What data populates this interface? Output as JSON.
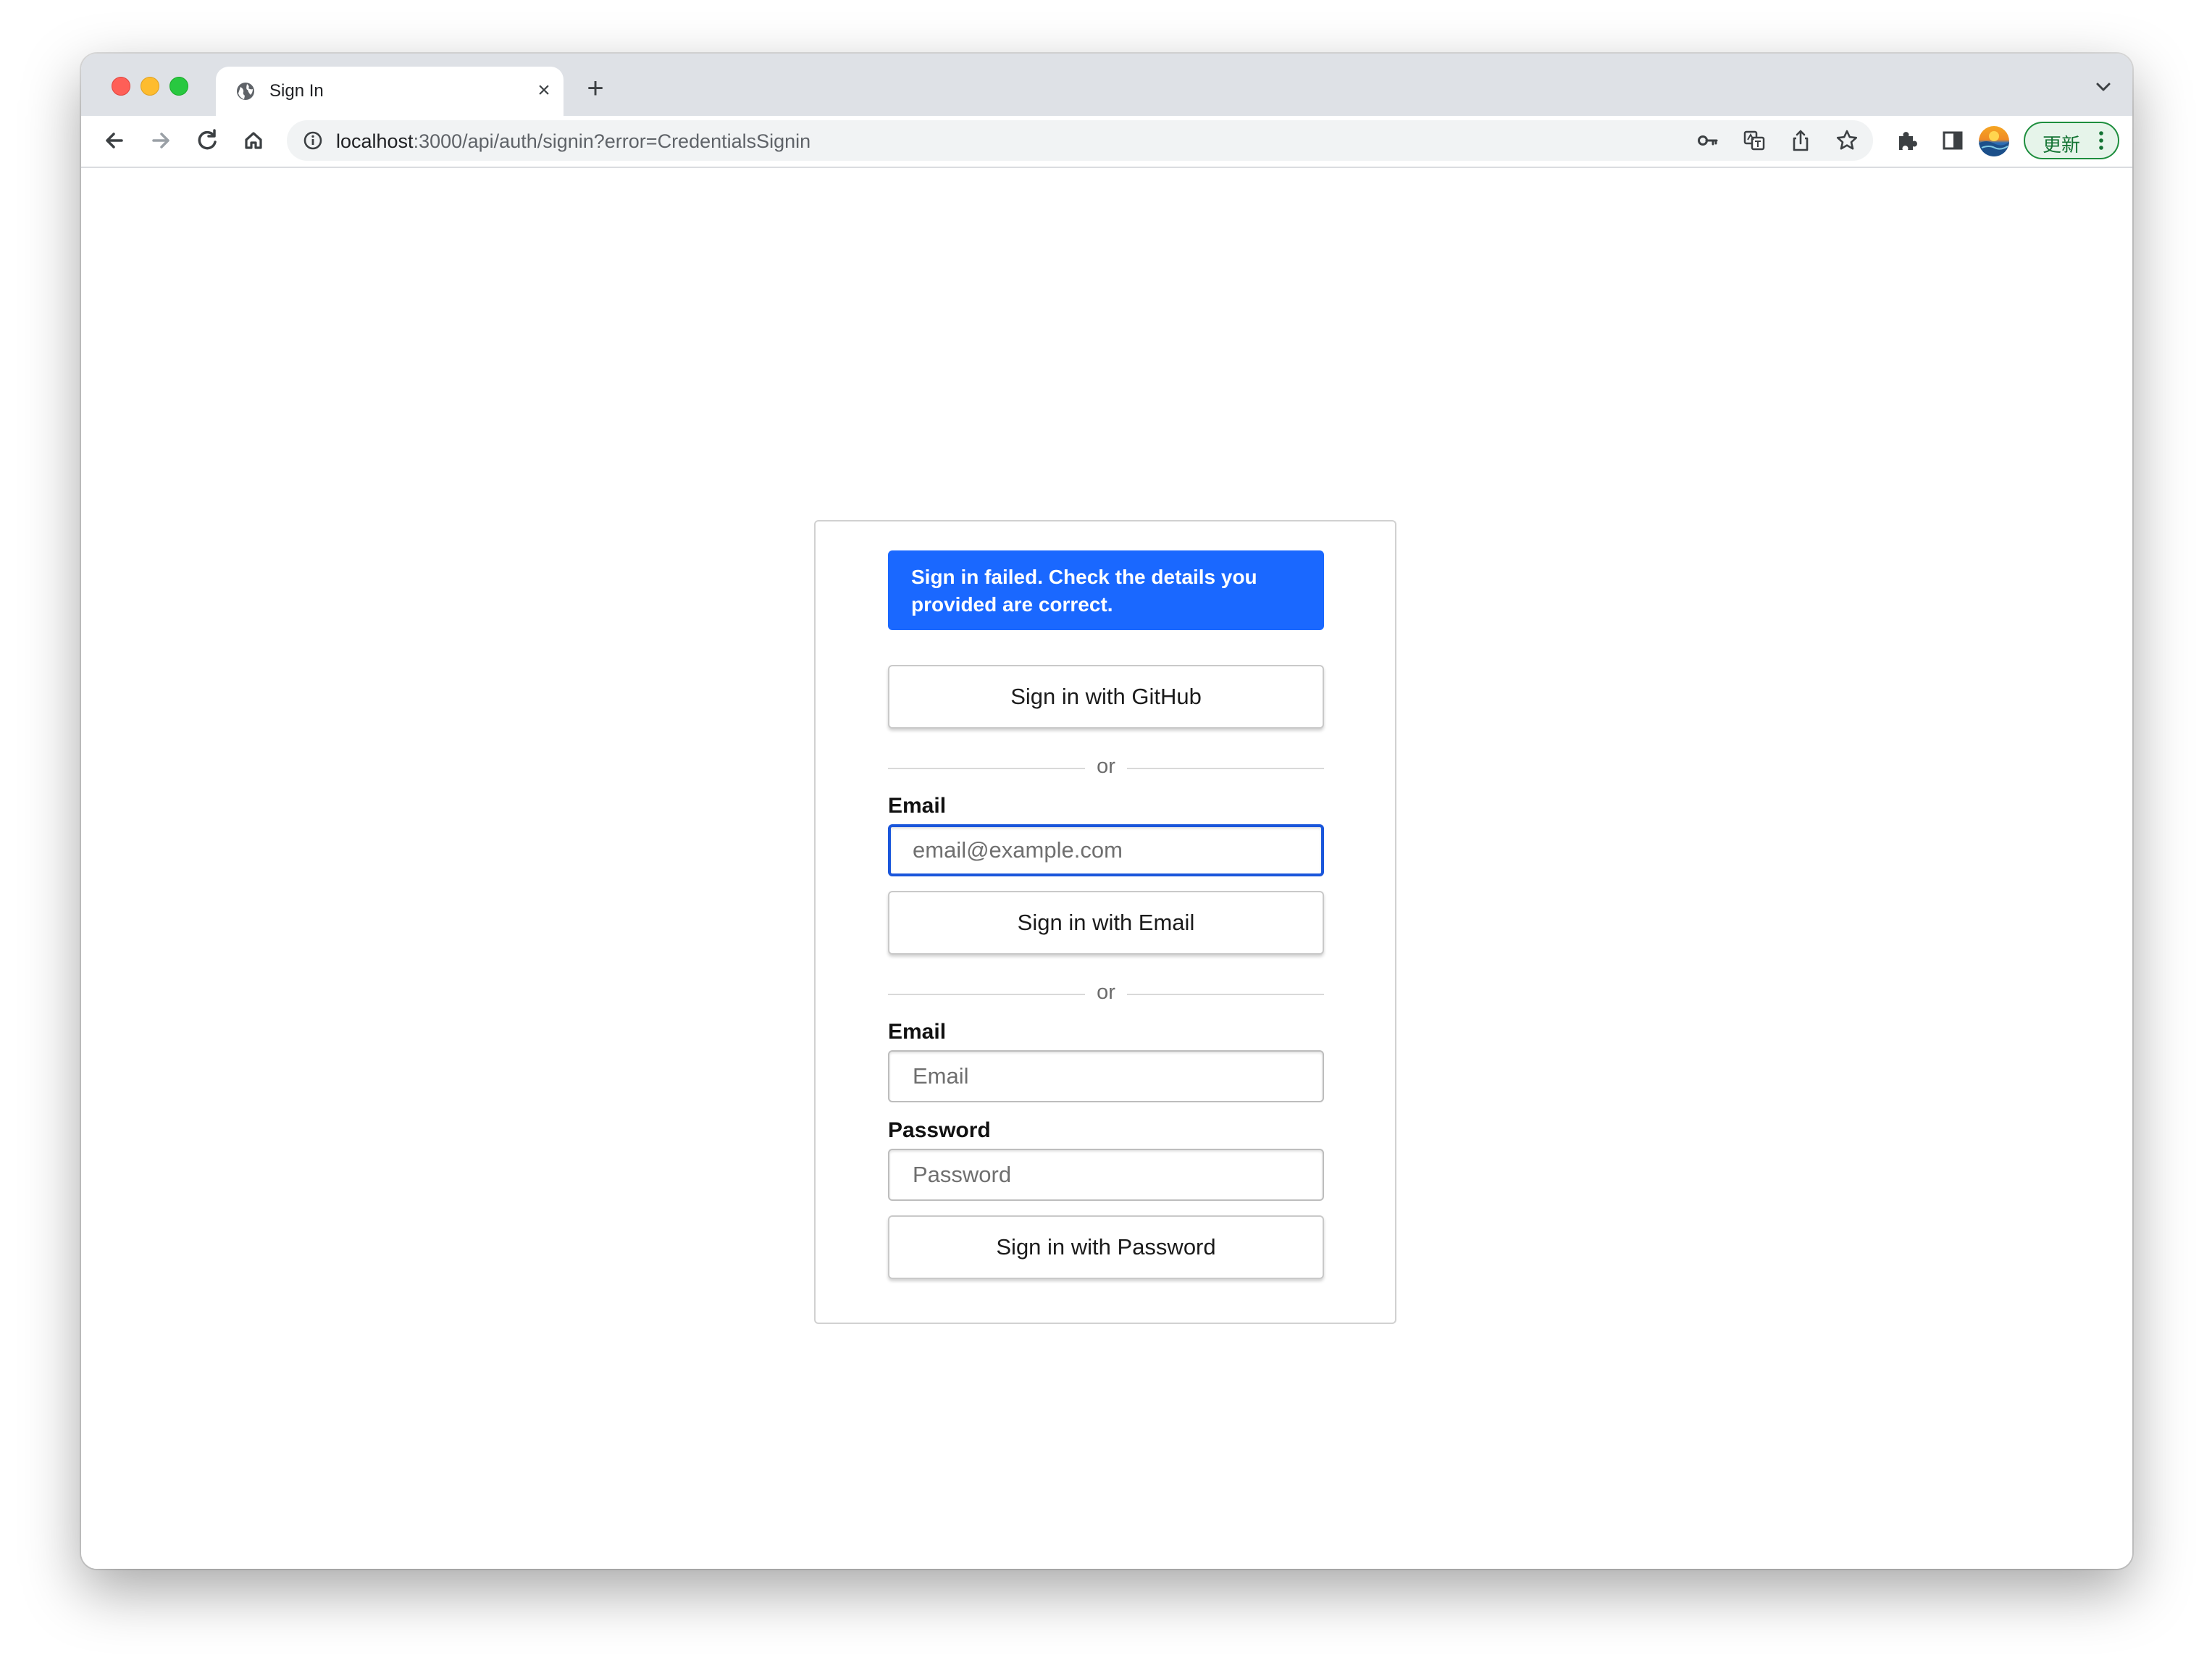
{
  "browser": {
    "tab": {
      "title": "Sign In",
      "close_glyph": "×"
    },
    "new_tab_glyph": "+",
    "url": {
      "host": "localhost",
      "rest": ":3000/api/auth/signin?error=CredentialsSignin"
    },
    "update_button": {
      "label": "更新"
    },
    "icons": [
      "globe-icon",
      "back-icon",
      "forward-icon",
      "reload-icon",
      "home-icon",
      "info-icon",
      "key-icon",
      "translate-icon",
      "share-icon",
      "star-icon",
      "extensions-icon",
      "side-panel-icon",
      "avatar",
      "more-icon",
      "chevron-down-icon"
    ]
  },
  "signin": {
    "error": "Sign in failed. Check the details you provided are correct.",
    "github_button": "Sign in with GitHub",
    "divider_text": "or",
    "email_section": {
      "label": "Email",
      "placeholder": "email@example.com",
      "button": "Sign in with Email"
    },
    "credentials_section": {
      "email_label": "Email",
      "email_placeholder": "Email",
      "password_label": "Password",
      "password_placeholder": "Password",
      "button": "Sign in with Password"
    }
  },
  "colors": {
    "error_banner": "#1a68ff",
    "focus_ring": "#1a56db",
    "update_green": "#137333"
  }
}
